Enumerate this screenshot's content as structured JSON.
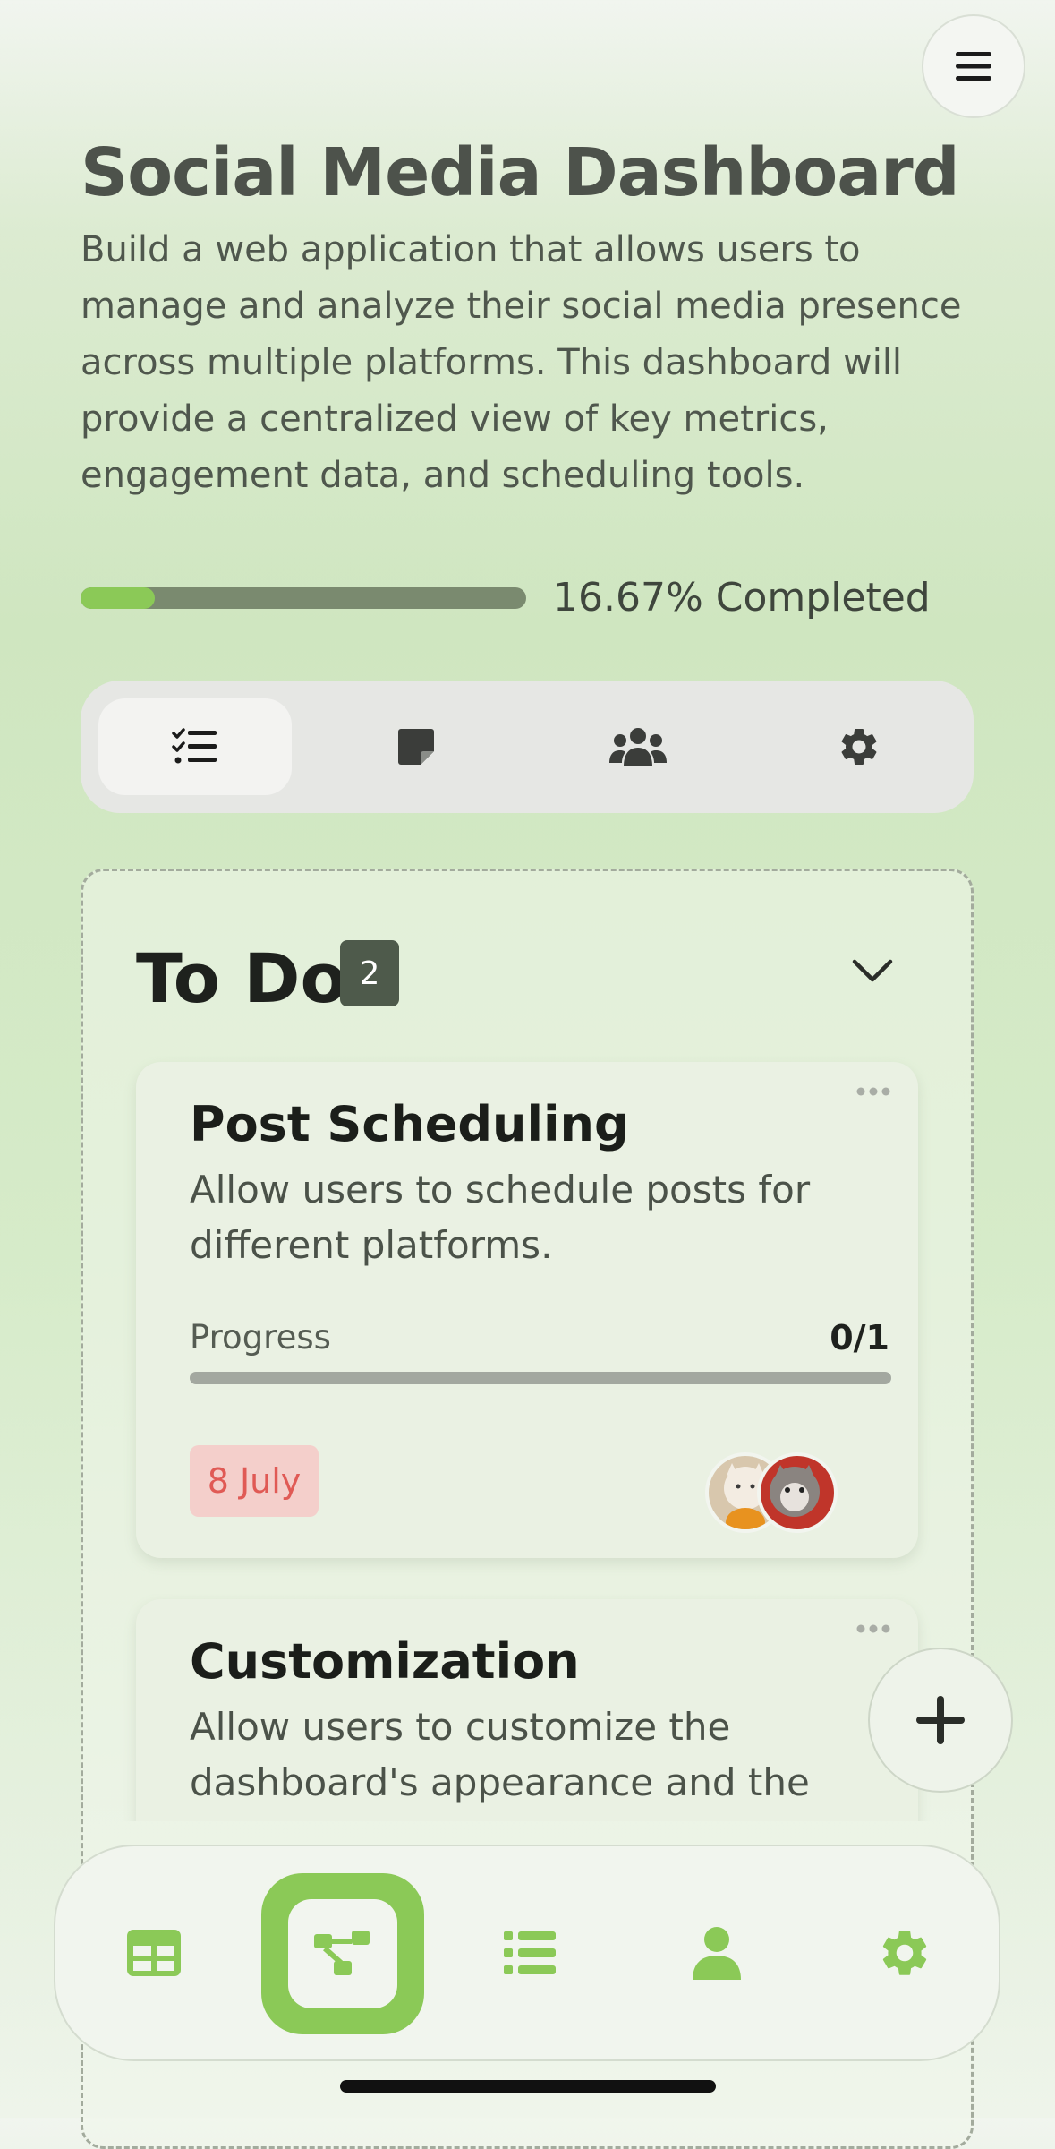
{
  "header": {
    "title": "Social Media Dashboard",
    "description": "Build a web application that allows users to manage and analyze their social media presence across multiple platforms. This dashboard will provide a centralized view of key metrics, engagement data, and scheduling tools.",
    "progress_fraction": 0.1667,
    "progress_label": "16.67% Completed"
  },
  "tabs": [
    {
      "icon": "checklist-icon",
      "active": true
    },
    {
      "icon": "note-icon",
      "active": false
    },
    {
      "icon": "team-icon",
      "active": false
    },
    {
      "icon": "gear-icon",
      "active": false
    }
  ],
  "column": {
    "title": "To Do",
    "count": "2"
  },
  "cards": [
    {
      "title": "Post Scheduling",
      "description": "Allow users to schedule posts for different platforms.",
      "progress_label": "Progress",
      "progress_value": "0/1",
      "progress_fraction": 0,
      "due_date": "8 July"
    },
    {
      "title": "Customization",
      "description": "Allow users to customize the dashboard's appearance and the"
    }
  ],
  "bottom_nav": [
    {
      "icon": "grid-icon",
      "active": false
    },
    {
      "icon": "flow-icon",
      "active": true
    },
    {
      "icon": "list-icon",
      "active": false
    },
    {
      "icon": "user-icon",
      "active": false
    },
    {
      "icon": "gear-icon",
      "active": false
    }
  ],
  "colors": {
    "accent": "#8bc957",
    "due_date_text": "#e05a55",
    "due_date_bg": "#f4cfcb"
  }
}
